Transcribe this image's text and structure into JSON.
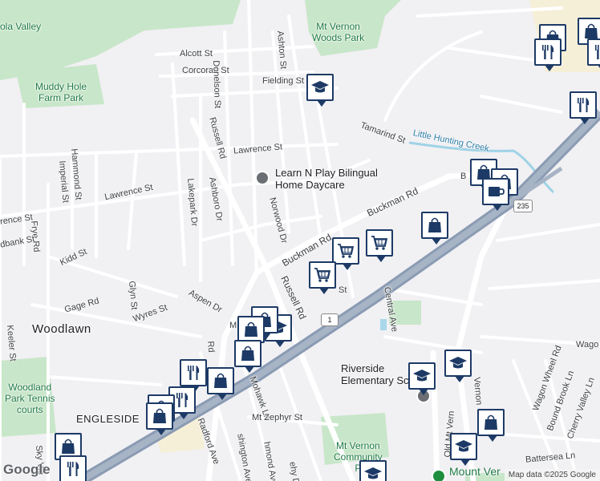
{
  "map": {
    "streets": {
      "alcott": "Alcott St",
      "corcoran": "Corcoran St",
      "donelson": "Donelson St",
      "ashton": "Ashton St",
      "fielding": "Fielding St",
      "tamarind": "Tamarind St",
      "lawrence_1": "Lawrence St",
      "lawrence_2": "Lawrence St",
      "lawrence_3": "rence St",
      "russell_upper": "Russell Rd",
      "russell_lower": "Russell Rd",
      "hammond": "Hammond St",
      "imperial": "Imperial St",
      "ashboro": "Ashboro Dr",
      "lakepark": "Lakepark Dr",
      "norwood": "Norwood Dr",
      "buckman_1": "Buckman Rd",
      "buckman_2": "Buckman Rd",
      "buckman_3": "B",
      "frye": "Frye Rd",
      "kidd": "Kidd St",
      "rdbank": "dbank St",
      "glyn": "Glyn St",
      "gage": "Gage Rd",
      "wyres": "Wyres St",
      "aspen": "Aspen Dr",
      "keeler": "Keeler St",
      "central": "Central Ave",
      "mohawk": "Mohawk Ln",
      "mt_zephyr": "Mt Zephyr St",
      "radford": "Radford Ave",
      "washington": "shington Ave",
      "richmond": "hmond Ave",
      "rd_short": "Rd",
      "sky_view": "Sky Vie",
      "old_mt_vernon": "Old Mt Vern",
      "vernon": "Vernon",
      "wagon_wheel": "Wagon Wheel Rd",
      "bound_brook": "Bound Brook Ln",
      "cherry_valley": "Cherry Valley Ln",
      "battersea": "Battersea Ln",
      "wago": "Wago",
      "st_short": "St",
      "m_short": "M",
      "ehy": "ehy Dr"
    },
    "parks": {
      "mt_vernon_woods": "Mt Vernon\nWoods Park",
      "muddy_hole": "Muddy Hole\nFarm Park",
      "pohick": "ola Valley",
      "woodland": "Woodland\nPark Tennis\ncourts",
      "mt_vernon_community": "Mt Vernon\nCommunity\nP"
    },
    "water": {
      "little_hunting": "Little Hunting Creek"
    },
    "places": {
      "learn_n_play": "Learn N Play Bilingual\nHome Daycare",
      "riverside": "Riverside\nElementary School",
      "mount_vernon": "Mount Ver"
    },
    "areas": {
      "woodlawn": "Woodlawn",
      "engleside": "ENGLESIDE"
    },
    "shields": {
      "us1": "1",
      "va235": "235"
    },
    "icons": [
      "school-icon",
      "restaurant-icon",
      "shopping-bag-icon",
      "shopping-cart-icon",
      "coffee-icon"
    ],
    "colors": {
      "marker_border": "#1d3a66",
      "park": "#c5e5c5",
      "highway": "#8f9fb5",
      "water": "#a8d8ea"
    }
  },
  "footer": {
    "logo": "Google",
    "attribution": "Map data ©2025 Google"
  }
}
